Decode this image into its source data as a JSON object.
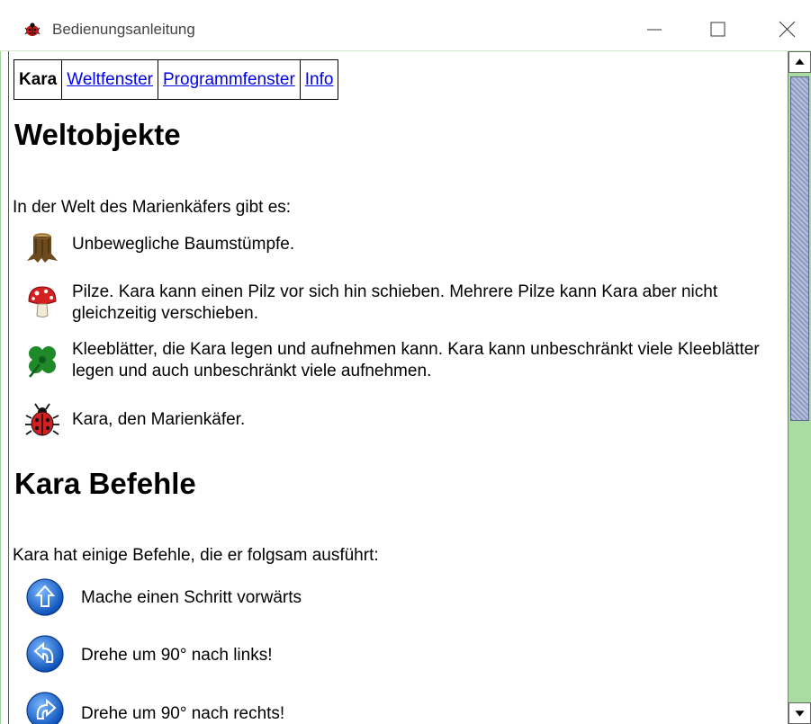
{
  "window": {
    "title": "Bedienungsanleitung"
  },
  "nav": {
    "current": "Kara",
    "links": [
      "Weltfenster",
      "Programmfenster",
      "Info"
    ]
  },
  "sections": {
    "weltobjekte": {
      "heading": "Weltobjekte",
      "intro": "In der Welt des Marienkäfers gibt es:",
      "items": [
        {
          "icon": "tree-stump-icon",
          "text": "Unbewegliche Baumstümpfe."
        },
        {
          "icon": "mushroom-icon",
          "text": "Pilze. Kara kann einen Pilz vor sich hin schieben. Mehrere Pilze kann Kara aber nicht gleichzeitig verschieben."
        },
        {
          "icon": "clover-leaf-icon",
          "text": "Kleeblätter, die Kara legen und aufnehmen kann. Kara kann unbeschränkt viele Kleeblätter legen und auch unbeschränkt viele aufnehmen."
        },
        {
          "icon": "ladybug-icon",
          "text": "Kara, den Marienkäfer."
        }
      ]
    },
    "befehle": {
      "heading": "Kara Befehle",
      "intro": "Kara hat einige Befehle, die er folgsam ausführt:",
      "commands": [
        {
          "icon": "move-forward-icon",
          "text": "Mache einen Schritt vorwärts"
        },
        {
          "icon": "turn-left-icon",
          "text": "Drehe um 90° nach links!"
        },
        {
          "icon": "turn-right-icon",
          "text": "Drehe um 90° nach rechts!"
        }
      ]
    }
  },
  "colors": {
    "link": "#0000ee",
    "scrollbar_track": "#a8dca0",
    "scroll_thumb": "#9aa6c8",
    "command_button": "#1e6fd9",
    "ladybug_red": "#d42020"
  }
}
